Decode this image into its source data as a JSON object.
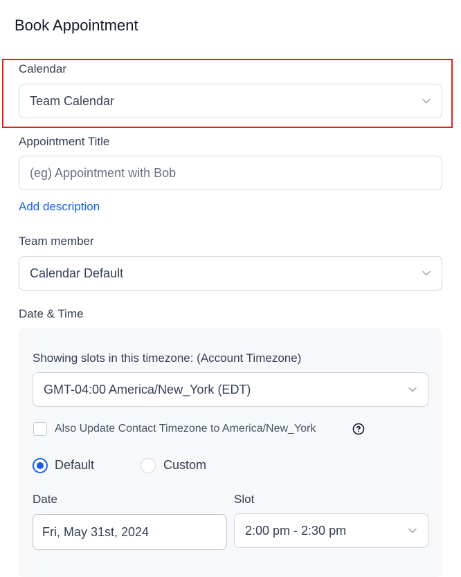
{
  "header": {
    "title": "Book Appointment"
  },
  "calendar": {
    "label": "Calendar",
    "value": "Team Calendar"
  },
  "appointment_title": {
    "label": "Appointment Title",
    "placeholder": "(eg) Appointment with Bob",
    "value": ""
  },
  "add_description": {
    "label": "Add description"
  },
  "team_member": {
    "label": "Team member",
    "value": "Calendar Default"
  },
  "date_time": {
    "label": "Date & Time",
    "timezone_label": "Showing slots in this timezone: (Account Timezone)",
    "timezone_value": "GMT-04:00 America/New_York (EDT)",
    "update_contact_tz_label": "Also Update Contact Timezone to America/New_York",
    "update_contact_tz_checked": false,
    "mode_options": [
      {
        "label": "Default",
        "selected": true
      },
      {
        "label": "Custom",
        "selected": false
      }
    ],
    "date": {
      "label": "Date",
      "value": "Fri, May 31st, 2024"
    },
    "slot": {
      "label": "Slot",
      "value": "2:00 pm - 2:30 pm"
    }
  },
  "icons": {
    "chevron": "chevron-down-icon",
    "help": "help-circle-icon"
  },
  "colors": {
    "accent": "#155eef",
    "highlight": "#e01e1e",
    "panel_bg": "#f7f8fa",
    "border": "#d0d5dd"
  }
}
